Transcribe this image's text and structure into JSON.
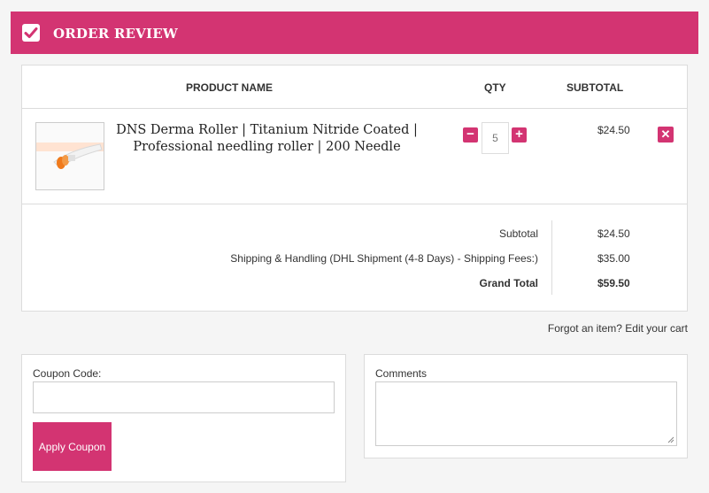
{
  "header": {
    "title": "ORDER REVIEW",
    "icon": "checkbox-checked-icon"
  },
  "table": {
    "columns": {
      "product": "PRODUCT NAME",
      "qty": "QTY",
      "subtotal": "SUBTOTAL"
    },
    "items": [
      {
        "name": "DNS Derma Roller | Titanium Nitride Coated | Professional needling roller | 200 Needle",
        "qty": "5",
        "price": "$24.50"
      }
    ]
  },
  "totals": {
    "subtotal_label": "Subtotal",
    "subtotal_value": "$24.50",
    "shipping_label": "Shipping & Handling (DHL Shipment (4-8 Days) - Shipping Fees:)",
    "shipping_value": "$35.00",
    "grand_label": "Grand Total",
    "grand_value": "$59.50"
  },
  "edit_cart": "Forgot an item? Edit your cart",
  "coupon": {
    "label": "Coupon Code:",
    "value": "",
    "button": "Apply Coupon"
  },
  "comments": {
    "label": "Comments",
    "value": ""
  },
  "colors": {
    "accent": "#d33472",
    "border": "#dcdcdc",
    "background": "#f5f5f5"
  }
}
